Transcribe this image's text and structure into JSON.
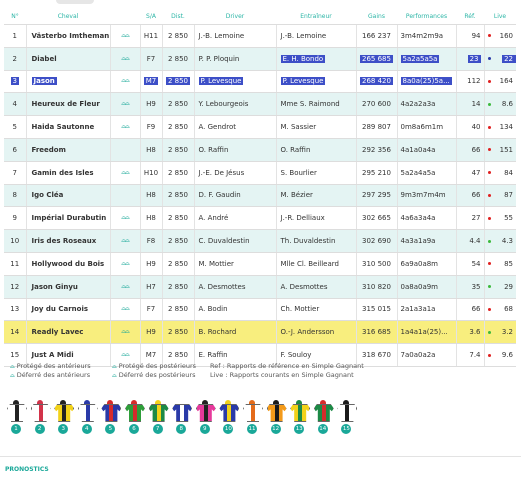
{
  "table": {
    "headers": {
      "num": "N°",
      "name": "Cheval",
      "sa": "S/A",
      "dist": "Dist.",
      "driver": "Driver",
      "trainer": "Entraîneur",
      "gains": "Gains",
      "perf": "Performances",
      "ref": "Réf.",
      "live": "Live"
    },
    "rows": [
      {
        "num": "1",
        "name": "Västerbo Imtheman",
        "icons": "🥚🥚",
        "sa": "H11",
        "dist": "2 850",
        "driver": "J.-B. Lemoine",
        "trainer": "J.-B. Lemoine",
        "gains": "166 237",
        "perf": "3m4m2m9a",
        "ref": "94",
        "live": "160",
        "trend": "red"
      },
      {
        "num": "2",
        "name": "Diabel",
        "icons": "🥚🥚",
        "sa": "F7",
        "dist": "2 850",
        "driver": "P. P. Ploquin",
        "trainer": "E. H. Bondo",
        "gains": "265 685",
        "perf": "5a2a5a5a",
        "ref": "23",
        "live": "22",
        "trend": "blue"
      },
      {
        "num": "3",
        "name": "Jason",
        "icons": "🥚🥚",
        "sa": "M7",
        "dist": "2 850",
        "driver": "P. Levesque",
        "trainer": "P. Levesque",
        "gains": "268 420",
        "perf": "8a0a(25)5a...",
        "ref": "112",
        "live": "164",
        "trend": "red"
      },
      {
        "num": "4",
        "name": "Heureux de Fleur",
        "icons": "🥚🥚",
        "sa": "H9",
        "dist": "2 850",
        "driver": "Y. Lebourgeois",
        "trainer": "Mme S. Raimond",
        "gains": "270 600",
        "perf": "4a2a2a3a",
        "ref": "14",
        "live": "8.6",
        "trend": "green"
      },
      {
        "num": "5",
        "name": "Haida Sautonne",
        "icons": "🥚🥚",
        "sa": "F9",
        "dist": "2 850",
        "driver": "A. Gendrot",
        "trainer": "M. Sassier",
        "gains": "289 807",
        "perf": "0m8a6m1m",
        "ref": "40",
        "live": "134",
        "trend": "red"
      },
      {
        "num": "6",
        "name": "Freedom",
        "icons": "",
        "sa": "H8",
        "dist": "2 850",
        "driver": "O. Raffin",
        "trainer": "O. Raffin",
        "gains": "292 356",
        "perf": "4a1a0a4a",
        "ref": "66",
        "live": "151",
        "trend": "red"
      },
      {
        "num": "7",
        "name": "Gamin des Isles",
        "icons": "🥚🥚",
        "sa": "H10",
        "dist": "2 850",
        "driver": "J.-E. De Jésus",
        "trainer": "S. Bourlier",
        "gains": "295 210",
        "perf": "5a2a4a5a",
        "ref": "47",
        "live": "84",
        "trend": "red"
      },
      {
        "num": "8",
        "name": "Igo Cléa",
        "icons": "",
        "sa": "H8",
        "dist": "2 850",
        "driver": "D. F. Gaudin",
        "trainer": "M. Bézier",
        "gains": "297 295",
        "perf": "9m3m7m4m",
        "ref": "66",
        "live": "87",
        "trend": "red"
      },
      {
        "num": "9",
        "name": "Impérial Durabutin",
        "icons": "🥚🥚",
        "sa": "H8",
        "dist": "2 850",
        "driver": "A. André",
        "trainer": "J.-R. Delliaux",
        "gains": "302 665",
        "perf": "4a6a3a4a",
        "ref": "27",
        "live": "55",
        "trend": "red"
      },
      {
        "num": "10",
        "name": "Iris des Roseaux",
        "icons": "🥚🥚",
        "sa": "F8",
        "dist": "2 850",
        "driver": "C. Duvaldestin",
        "trainer": "Th. Duvaldestin",
        "gains": "302 690",
        "perf": "4a3a1a9a",
        "ref": "4.4",
        "live": "4.3",
        "trend": "green"
      },
      {
        "num": "11",
        "name": "Hollywood du Bois",
        "icons": "🥚🥚",
        "sa": "H9",
        "dist": "2 850",
        "driver": "M. Mottier",
        "trainer": "Mlle Cl. Beilleard",
        "gains": "310 500",
        "perf": "6a9a0a8m",
        "ref": "54",
        "live": "85",
        "trend": "red"
      },
      {
        "num": "12",
        "name": "Jason Ginyu",
        "icons": "🥚🥚",
        "sa": "H7",
        "dist": "2 850",
        "driver": "A. Desmottes",
        "trainer": "A. Desmottes",
        "gains": "310 820",
        "perf": "0a8a0a9m",
        "ref": "35",
        "live": "29",
        "trend": "green"
      },
      {
        "num": "13",
        "name": "Joy du Carnois",
        "icons": "🥚🥚",
        "sa": "F7",
        "dist": "2 850",
        "driver": "A. Bodin",
        "trainer": "Ch. Mottier",
        "gains": "315 015",
        "perf": "2a1a3a1a",
        "ref": "66",
        "live": "68",
        "trend": "red"
      },
      {
        "num": "14",
        "name": "Readly Lavec",
        "icons": "🥚🥚",
        "sa": "H9",
        "dist": "2 850",
        "driver": "B. Rochard",
        "trainer": "O.-J. Andersson",
        "gains": "316 685",
        "perf": "1a4a1a(25)...",
        "ref": "3.6",
        "live": "3.2",
        "trend": "green"
      },
      {
        "num": "15",
        "name": "Just A Midi",
        "icons": "🥚🥚",
        "sa": "M7",
        "dist": "2 850",
        "driver": "E. Raffin",
        "trainer": "F. Souloy",
        "gains": "318 670",
        "perf": "7a0a0a2a",
        "ref": "7.4",
        "live": "9.6",
        "trend": "red"
      }
    ]
  },
  "legend": {
    "icon": "horseshoe-icon",
    "prot_ant": "Protégé des antérieurs",
    "def_ant": "Déferré des antérieurs",
    "prot_post": "Protégé des postérieurs",
    "def_post": "Déferré des postérieurs",
    "ref": "Ref : Rapports de référence en Simple Gagnant",
    "live": "Live : Rapports courants en Simple Gagnant"
  },
  "jackets": [
    {
      "n": "1",
      "main": "#ffffff",
      "accent": "#222222"
    },
    {
      "n": "2",
      "main": "#ffffff",
      "accent": "#d2334a"
    },
    {
      "n": "3",
      "main": "#f2d21a",
      "accent": "#222222"
    },
    {
      "n": "4",
      "main": "#ffffff",
      "accent": "#2a3aa8"
    },
    {
      "n": "5",
      "main": "#2a3aa8",
      "accent": "#d62b2b"
    },
    {
      "n": "6",
      "main": "#2e9e3a",
      "accent": "#d62b2b"
    },
    {
      "n": "7",
      "main": "#1c8a46",
      "accent": "#f2d21a"
    },
    {
      "n": "8",
      "main": "#2a3aa8",
      "accent": "#ffffff"
    },
    {
      "n": "9",
      "main": "#e6399b",
      "accent": "#222222"
    },
    {
      "n": "10",
      "main": "#2a3aa8",
      "accent": "#f2d21a"
    },
    {
      "n": "11",
      "main": "#ffffff",
      "accent": "#e46b1a"
    },
    {
      "n": "12",
      "main": "#f39a1a",
      "accent": "#1a1a1a"
    },
    {
      "n": "13",
      "main": "#f2d21a",
      "accent": "#1c8a46"
    },
    {
      "n": "14",
      "main": "#1c8a46",
      "accent": "#d62b2b"
    },
    {
      "n": "15",
      "main": "#ffffff",
      "accent": "#1a1a1a"
    }
  ],
  "colors": {
    "accent": "#1aa899",
    "selection": "#3d4fc7",
    "highlight": "#f8ee7e",
    "trend_red": "#e02020",
    "trend_green": "#3cb93c",
    "trend_blue": "#2a3aa8"
  },
  "footer": {
    "pronostics": "PRONOSTICS"
  }
}
